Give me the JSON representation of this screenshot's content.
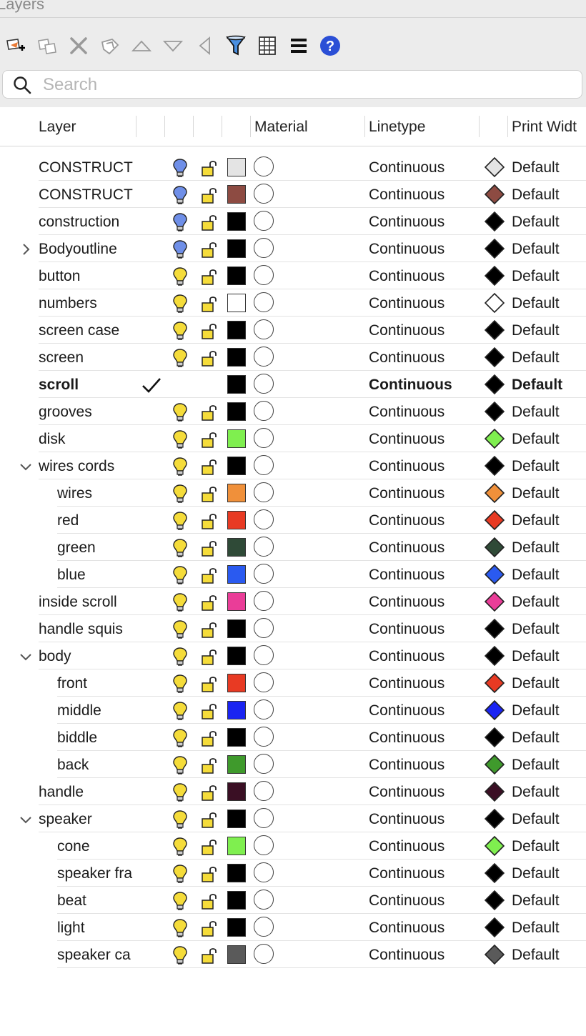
{
  "window": {
    "title": "Layers"
  },
  "toolbar": {
    "buttons": [
      {
        "name": "new-layer-button",
        "icon": "new-layer-icon"
      },
      {
        "name": "new-sublayer-button",
        "icon": "new-sublayer-icon"
      },
      {
        "name": "delete-button",
        "icon": "delete-icon"
      },
      {
        "name": "delete-layer-button",
        "icon": "delete-layer-icon"
      },
      {
        "name": "move-up-button",
        "icon": "triangle-up-icon"
      },
      {
        "name": "move-down-button",
        "icon": "triangle-down-icon"
      },
      {
        "name": "move-out-button",
        "icon": "triangle-left-icon"
      },
      {
        "name": "filter-button",
        "icon": "funnel-icon"
      },
      {
        "name": "table-button",
        "icon": "grid-icon"
      },
      {
        "name": "menu-button",
        "icon": "hamburger-icon"
      },
      {
        "name": "help-button",
        "icon": "help-icon"
      }
    ]
  },
  "search": {
    "placeholder": "Search",
    "value": ""
  },
  "columns": {
    "layer": "Layer",
    "material": "Material",
    "linetype": "Linetype",
    "print_width": "Print Widt"
  },
  "colors": {
    "bulb_on_blue": "#6f8fe8",
    "bulb_on_yellow": "#f5dc3a",
    "lock_yellow": "#f5dc3a"
  },
  "layers": [
    {
      "name": "CONSTRUCT",
      "indent": 0,
      "expander": "none",
      "bulb": "blue",
      "color": "#e4e4e4",
      "linetype": "Continuous",
      "print_width": "Default"
    },
    {
      "name": "CONSTRUCT",
      "indent": 0,
      "expander": "none",
      "bulb": "blue",
      "color": "#8d4b42",
      "linetype": "Continuous",
      "print_width": "Default"
    },
    {
      "name": "construction",
      "indent": 0,
      "expander": "none",
      "bulb": "blue",
      "color": "#000000",
      "linetype": "Continuous",
      "print_width": "Default"
    },
    {
      "name": "Bodyoutline",
      "indent": 0,
      "expander": "collapsed",
      "bulb": "blue",
      "color": "#000000",
      "linetype": "Continuous",
      "print_width": "Default"
    },
    {
      "name": "button",
      "indent": 0,
      "expander": "none",
      "bulb": "yellow",
      "color": "#000000",
      "linetype": "Continuous",
      "print_width": "Default"
    },
    {
      "name": "numbers",
      "indent": 0,
      "expander": "none",
      "bulb": "yellow",
      "color": "#ffffff",
      "linetype": "Continuous",
      "print_width": "Default"
    },
    {
      "name": "screen case",
      "indent": 0,
      "expander": "none",
      "bulb": "yellow",
      "color": "#000000",
      "linetype": "Continuous",
      "print_width": "Default"
    },
    {
      "name": "screen",
      "indent": 0,
      "expander": "none",
      "bulb": "yellow",
      "color": "#000000",
      "linetype": "Continuous",
      "print_width": "Default"
    },
    {
      "name": "scroll",
      "indent": 0,
      "expander": "none",
      "current": true,
      "color": "#000000",
      "linetype": "Continuous",
      "print_width": "Default"
    },
    {
      "name": "grooves",
      "indent": 0,
      "expander": "none",
      "bulb": "yellow",
      "color": "#000000",
      "linetype": "Continuous",
      "print_width": "Default"
    },
    {
      "name": "disk",
      "indent": 0,
      "expander": "none",
      "bulb": "yellow",
      "color": "#7fef4f",
      "linetype": "Continuous",
      "print_width": "Default"
    },
    {
      "name": "wires cords",
      "indent": 0,
      "expander": "expanded",
      "bulb": "yellow",
      "color": "#000000",
      "linetype": "Continuous",
      "print_width": "Default"
    },
    {
      "name": "wires",
      "indent": 1,
      "expander": "none",
      "bulb": "yellow",
      "color": "#f0903a",
      "linetype": "Continuous",
      "print_width": "Default"
    },
    {
      "name": "red",
      "indent": 1,
      "expander": "none",
      "bulb": "yellow",
      "color": "#e83a23",
      "linetype": "Continuous",
      "print_width": "Default"
    },
    {
      "name": "green",
      "indent": 1,
      "expander": "none",
      "bulb": "yellow",
      "color": "#2f4a37",
      "linetype": "Continuous",
      "print_width": "Default"
    },
    {
      "name": "blue",
      "indent": 1,
      "expander": "none",
      "bulb": "yellow",
      "color": "#2a5af0",
      "linetype": "Continuous",
      "print_width": "Default"
    },
    {
      "name": "inside scroll",
      "indent": 0,
      "expander": "none",
      "bulb": "yellow",
      "color": "#ea3d98",
      "linetype": "Continuous",
      "print_width": "Default"
    },
    {
      "name": "handle squis",
      "indent": 0,
      "expander": "none",
      "bulb": "yellow",
      "color": "#000000",
      "linetype": "Continuous",
      "print_width": "Default"
    },
    {
      "name": "body",
      "indent": 0,
      "expander": "expanded",
      "bulb": "yellow",
      "color": "#000000",
      "linetype": "Continuous",
      "print_width": "Default"
    },
    {
      "name": "front",
      "indent": 1,
      "expander": "none",
      "bulb": "yellow",
      "color": "#e83a23",
      "linetype": "Continuous",
      "print_width": "Default"
    },
    {
      "name": "middle",
      "indent": 1,
      "expander": "none",
      "bulb": "yellow",
      "color": "#1a24f2",
      "linetype": "Continuous",
      "print_width": "Default"
    },
    {
      "name": "biddle",
      "indent": 1,
      "expander": "none",
      "bulb": "yellow",
      "color": "#000000",
      "linetype": "Continuous",
      "print_width": "Default"
    },
    {
      "name": "back",
      "indent": 1,
      "expander": "none",
      "bulb": "yellow",
      "color": "#3f9a2c",
      "linetype": "Continuous",
      "print_width": "Default"
    },
    {
      "name": "handle",
      "indent": 0,
      "expander": "none",
      "bulb": "yellow",
      "color": "#3a0f24",
      "linetype": "Continuous",
      "print_width": "Default"
    },
    {
      "name": "speaker",
      "indent": 0,
      "expander": "expanded",
      "bulb": "yellow",
      "color": "#000000",
      "linetype": "Continuous",
      "print_width": "Default"
    },
    {
      "name": "cone",
      "indent": 1,
      "expander": "none",
      "bulb": "yellow",
      "color": "#7fef4f",
      "linetype": "Continuous",
      "print_width": "Default"
    },
    {
      "name": "speaker fra",
      "indent": 1,
      "expander": "none",
      "bulb": "yellow",
      "color": "#000000",
      "linetype": "Continuous",
      "print_width": "Default"
    },
    {
      "name": "beat",
      "indent": 1,
      "expander": "none",
      "bulb": "yellow",
      "color": "#000000",
      "linetype": "Continuous",
      "print_width": "Default"
    },
    {
      "name": "light",
      "indent": 1,
      "expander": "none",
      "bulb": "yellow",
      "color": "#000000",
      "linetype": "Continuous",
      "print_width": "Default"
    },
    {
      "name": "speaker ca",
      "indent": 1,
      "expander": "none",
      "bulb": "yellow",
      "color": "#5a5a5a",
      "linetype": "Continuous",
      "print_width": "Default"
    }
  ]
}
